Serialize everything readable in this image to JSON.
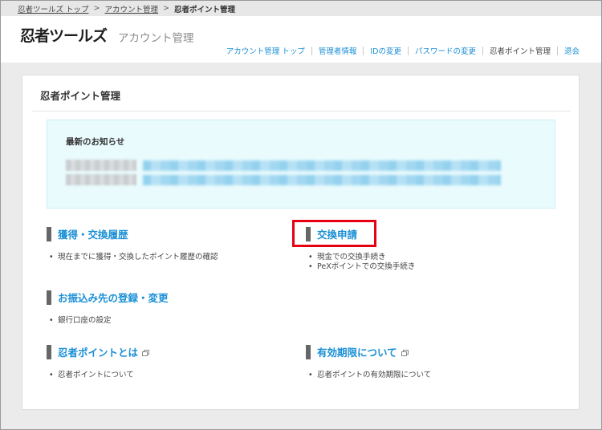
{
  "breadcrumb": {
    "items": [
      {
        "label": "忍者ツールズ トップ"
      },
      {
        "label": "アカウント管理"
      }
    ],
    "separator": ">",
    "current": "忍者ポイント管理"
  },
  "header": {
    "logo": "忍者ツールズ",
    "subtitle": "アカウント管理",
    "nav": [
      {
        "label": "アカウント管理 トップ"
      },
      {
        "label": "管理者情報"
      },
      {
        "label": "IDの変更"
      },
      {
        "label": "パスワードの変更"
      },
      {
        "label": "忍者ポイント管理"
      },
      {
        "label": "退会"
      }
    ]
  },
  "main": {
    "title": "忍者ポイント管理",
    "news": {
      "title": "最新のお知らせ"
    },
    "sections": {
      "history": {
        "title": "獲得・交換履歴",
        "items": [
          "現在までに獲得・交換したポイント履歴の確認"
        ]
      },
      "exchange": {
        "title": "交換申請",
        "items": [
          "現金での交換手続き",
          "PeXポイントでの交換手続き"
        ]
      },
      "transfer": {
        "title": "お振込み先の登録・変更",
        "items": [
          "銀行口座の設定"
        ]
      },
      "about": {
        "title": "忍者ポイントとは",
        "items": [
          "忍者ポイントについて"
        ]
      },
      "expiry": {
        "title": "有効期限について",
        "items": [
          "忍者ポイントの有効期限について"
        ]
      }
    }
  },
  "colors": {
    "link": "#1a8fd6",
    "highlight": "#e60012",
    "news_bg": "#e9fbfd"
  }
}
